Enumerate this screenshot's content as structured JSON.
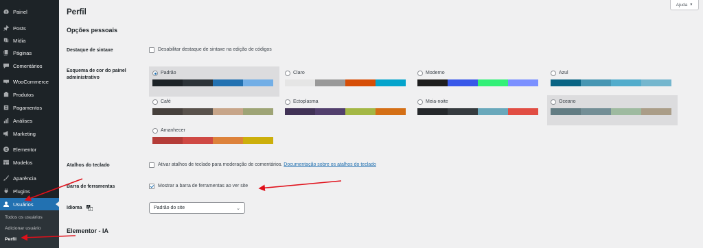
{
  "sidebar": {
    "items": [
      {
        "label": "Painel",
        "icon": "dashboard-icon"
      },
      {
        "label": "Posts",
        "icon": "pushpin-icon"
      },
      {
        "label": "Mídia",
        "icon": "media-icon"
      },
      {
        "label": "Páginas",
        "icon": "pages-icon"
      },
      {
        "label": "Comentários",
        "icon": "comments-icon"
      },
      {
        "label": "WooCommerce",
        "icon": "woocommerce-icon"
      },
      {
        "label": "Produtos",
        "icon": "products-icon"
      },
      {
        "label": "Pagamentos",
        "icon": "payments-icon"
      },
      {
        "label": "Análises",
        "icon": "analytics-icon"
      },
      {
        "label": "Marketing",
        "icon": "megaphone-icon"
      },
      {
        "label": "Elementor",
        "icon": "elementor-icon"
      },
      {
        "label": "Modelos",
        "icon": "templates-icon"
      },
      {
        "label": "Aparência",
        "icon": "appearance-icon"
      },
      {
        "label": "Plugins",
        "icon": "plugins-icon"
      },
      {
        "label": "Usuários",
        "icon": "users-icon"
      }
    ],
    "submenu": [
      "Todos os usuários",
      "Adicionar usuário",
      "Perfil"
    ]
  },
  "help": {
    "label": "Ajuda"
  },
  "page": {
    "title": "Perfil"
  },
  "sections": {
    "personal_options": "Opções pessoais",
    "elementor_ai": "Elementor - IA"
  },
  "fields": {
    "syntax": {
      "label": "Destaque de sintaxe",
      "option": "Desabilitar destaque de sintaxe na edição de códigos",
      "checked": false
    },
    "color_scheme": {
      "label": "Esquema de cor do painel administrativo",
      "selected": "Padrão",
      "schemes": [
        {
          "name": "Padrão",
          "colors": [
            "#1d2327",
            "#2c3338",
            "#2271b1",
            "#72aee6"
          ]
        },
        {
          "name": "Claro",
          "colors": [
            "#e5e5e5",
            "#999999",
            "#d64e07",
            "#04a4cc"
          ]
        },
        {
          "name": "Moderno",
          "colors": [
            "#1e1e1e",
            "#3858e9",
            "#33f078",
            "#7b90ff"
          ]
        },
        {
          "name": "Azul",
          "colors": [
            "#096484",
            "#4796b3",
            "#52accc",
            "#74b6ce"
          ]
        },
        {
          "name": "Café",
          "colors": [
            "#46403c",
            "#59524c",
            "#c7a589",
            "#9ea476"
          ]
        },
        {
          "name": "Ectoplasma",
          "colors": [
            "#413256",
            "#523f6d",
            "#a3b745",
            "#d46f15"
          ]
        },
        {
          "name": "Meia-noite",
          "colors": [
            "#25282b",
            "#363b3f",
            "#69a8bb",
            "#e14d43"
          ]
        },
        {
          "name": "Oceano",
          "colors": [
            "#627c83",
            "#738e96",
            "#9ebaa0",
            "#aa9d88"
          ]
        },
        {
          "name": "Amanhecer",
          "colors": [
            "#b43c38",
            "#cf4944",
            "#dd823b",
            "#ccaf0b"
          ]
        }
      ]
    },
    "shortcuts": {
      "label": "Atalhos do teclado",
      "option": "Ativar atalhos de teclado para moderação de comentários.",
      "link": "Documentação sobre os atalhos do teclado",
      "checked": false
    },
    "toolbar": {
      "label": "Barra de ferramentas",
      "option": "Mostrar a barra de ferramentas ao ver site",
      "checked": true
    },
    "language": {
      "label": "Idioma",
      "value": "Padrão do site"
    }
  },
  "colors": {
    "accent": "#2271b1",
    "sidebar_bg": "#1d2327",
    "annotation": "#e0101a"
  }
}
